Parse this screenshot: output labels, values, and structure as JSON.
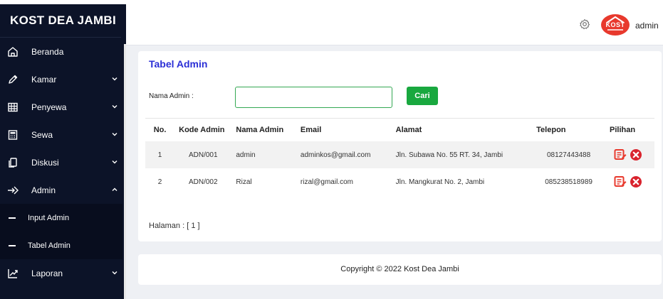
{
  "sidebar": {
    "brand": "KOST DEA JAMBI",
    "items": [
      {
        "label": "Beranda"
      },
      {
        "label": "Kamar"
      },
      {
        "label": "Penyewa"
      },
      {
        "label": "Sewa"
      },
      {
        "label": "Diskusi"
      },
      {
        "label": "Admin"
      },
      {
        "label": "Laporan"
      }
    ],
    "sub_items": [
      {
        "label": "Input Admin"
      },
      {
        "label": "Tabel Admin"
      }
    ]
  },
  "topbar": {
    "logo_text": "KOST",
    "user_name": "admin"
  },
  "card": {
    "title": "Tabel Admin",
    "search_label": "Nama Admin :",
    "search_value": "",
    "search_placeholder": "",
    "search_button": "Cari",
    "columns": [
      "No.",
      "Kode Admin",
      "Nama Admin",
      "Email",
      "Alamat",
      "Telepon",
      "Pilihan"
    ],
    "rows": [
      {
        "no": "1",
        "kode": "ADN/001",
        "nama": "admin",
        "email": "adminkos@gmail.com",
        "alamat": "Jln. Subawa No. 55 RT. 34, Jambi",
        "telepon": "08127443488"
      },
      {
        "no": "2",
        "kode": "ADN/002",
        "nama": "Rizal",
        "email": "rizal@gmail.com",
        "alamat": "Jln. Mangkurat No. 2, Jambi",
        "telepon": "085238518989"
      }
    ],
    "paging_label": "Halaman :",
    "paging_value": "[ 1 ]"
  },
  "footer": {
    "copyright": "Copyright © 2022 Kost Dea Jambi"
  },
  "colors": {
    "sidebar_bg": "#0c1328",
    "title_blue": "#2b2fd6",
    "button_green": "#19a83f",
    "edit_red": "#e8392d",
    "delete_red": "#d9232d"
  }
}
